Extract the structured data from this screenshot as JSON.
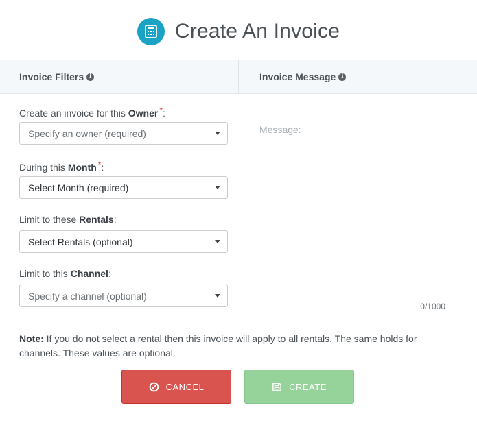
{
  "header": {
    "title": "Create An Invoice",
    "icon": "calculator-icon",
    "icon_color": "#1aa3c3"
  },
  "tabs": [
    {
      "label": "Invoice Filters",
      "icon": "info-icon"
    },
    {
      "label": "Invoice Message",
      "icon": "info-icon"
    }
  ],
  "filters": [
    {
      "prefix": "Create an invoice for this ",
      "strong": "Owner",
      "required_mark": "*",
      "suffix": ":",
      "value": "Specify an owner (required)",
      "placeholder": true
    },
    {
      "prefix": "During this ",
      "strong": "Month",
      "required_mark": "*",
      "suffix": ":",
      "value": "Select Month (required)",
      "placeholder": false
    },
    {
      "prefix": "Limit to these ",
      "strong": "Rentals",
      "required_mark": "",
      "suffix": ":",
      "value": "Select Rentals (optional)",
      "placeholder": false
    },
    {
      "prefix": "Limit to this ",
      "strong": "Channel",
      "required_mark": "",
      "suffix": ":",
      "value": "Specify a channel (optional)",
      "placeholder": true
    }
  ],
  "message": {
    "placeholder": "Message:",
    "counter": "0/1000"
  },
  "note": {
    "label": "Note:",
    "text": " If you do not select a rental then this invoice will apply to all rentals. The same holds for channels. These values are optional."
  },
  "buttons": {
    "cancel_label": "CANCEL",
    "create_label": "CREATE",
    "cancel_color": "#d9534f",
    "create_color": "#95d39a"
  }
}
